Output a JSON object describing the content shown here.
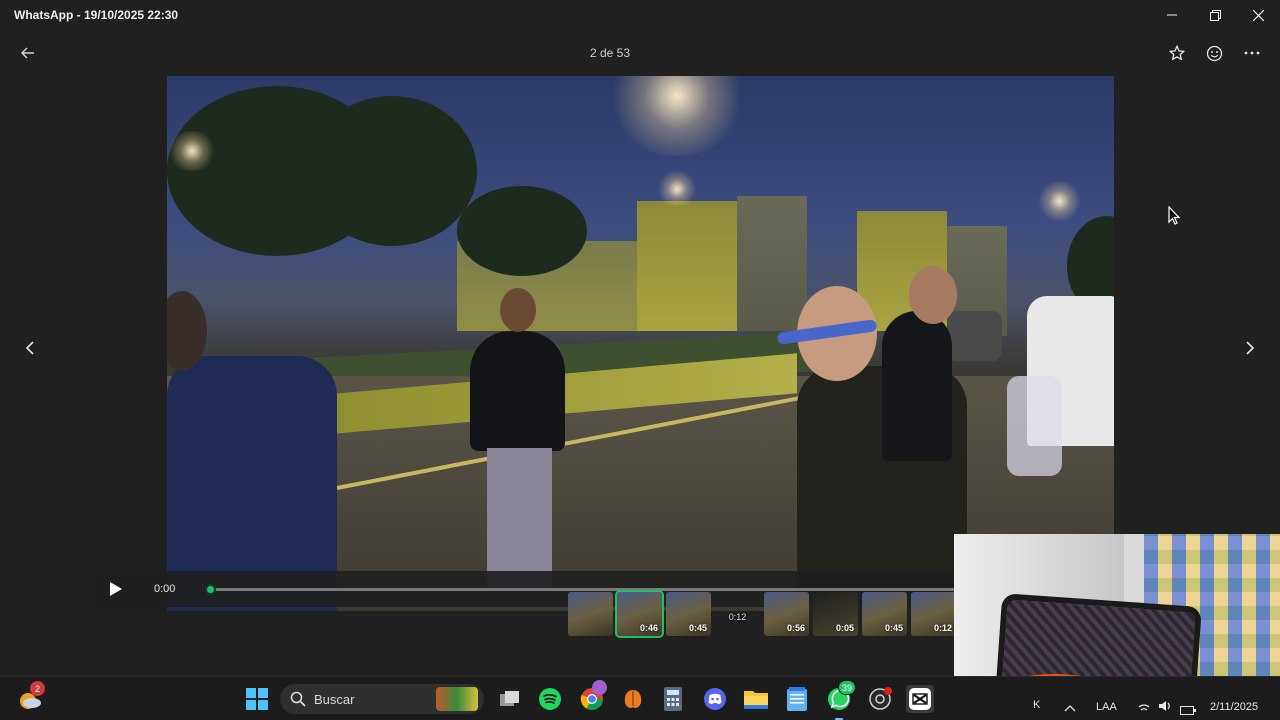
{
  "window": {
    "title": "WhatsApp - 19/10/2025 22:30",
    "controls": [
      "minimize-icon",
      "restore-icon",
      "close-icon"
    ]
  },
  "viewer": {
    "counter": "2 de 53",
    "header_icons": [
      "back-arrow-icon",
      "star-icon",
      "smiley-icon",
      "more-icon"
    ]
  },
  "player": {
    "current_time": "0:00",
    "progress": 0
  },
  "thumbnails": [
    {
      "duration": ""
    },
    {
      "duration": "0:46",
      "selected": true
    },
    {
      "duration": "0:45"
    },
    {
      "duration": "0:12",
      "blank": true
    },
    {
      "duration": "0:56"
    },
    {
      "duration": "0:05"
    },
    {
      "duration": "0:45"
    },
    {
      "duration": "0:12"
    }
  ],
  "taskbar": {
    "search_placeholder": "Buscar",
    "weather_badge": "2",
    "chrome_badge": "",
    "whatsapp_badge": "39",
    "tray_lang": "LAA",
    "tray_date": "2/11/2025",
    "tray_letter": "K"
  },
  "colors": {
    "accent": "#21c063",
    "background": "#202020",
    "taskbar": "#1c1c1c"
  }
}
